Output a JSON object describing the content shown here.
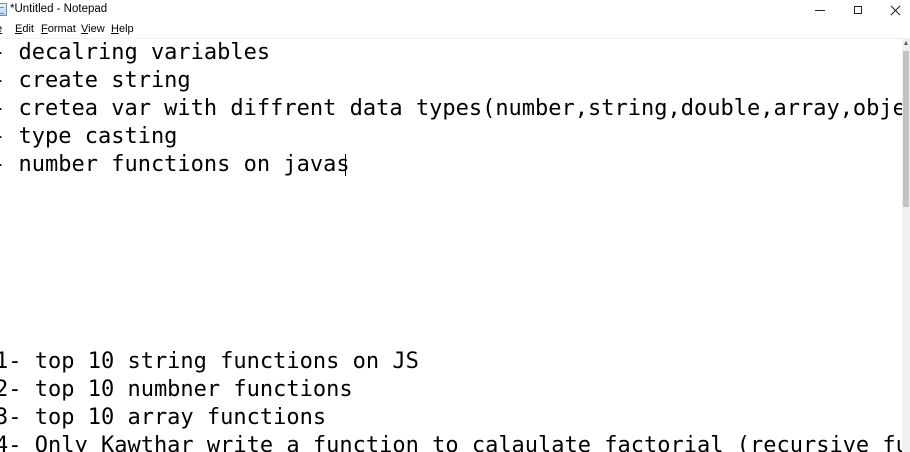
{
  "window": {
    "title": "*Untitled - Notepad"
  },
  "menu": {
    "file": "e",
    "edit": "Edit",
    "format": "Format",
    "view": "View",
    "help": "Help"
  },
  "editor": {
    "lines": [
      "- decalring variables",
      "- create string",
      "- cretea var with diffrent data types(number,string,double,array,obje",
      "- type casting",
      "- number functions on javas",
      "1- top 10 string functions on JS",
      "2- top 10 numbner functions",
      "3- top 10 array functions",
      "4- Only Kawthar write a function to calaulate factorial (recursive fu"
    ]
  },
  "icons": {
    "app": "notepad-icon",
    "minimize": "minimize-icon",
    "maximize": "maximize-icon",
    "close": "close-icon",
    "scroll_up": "scroll-up-arrow-icon"
  }
}
